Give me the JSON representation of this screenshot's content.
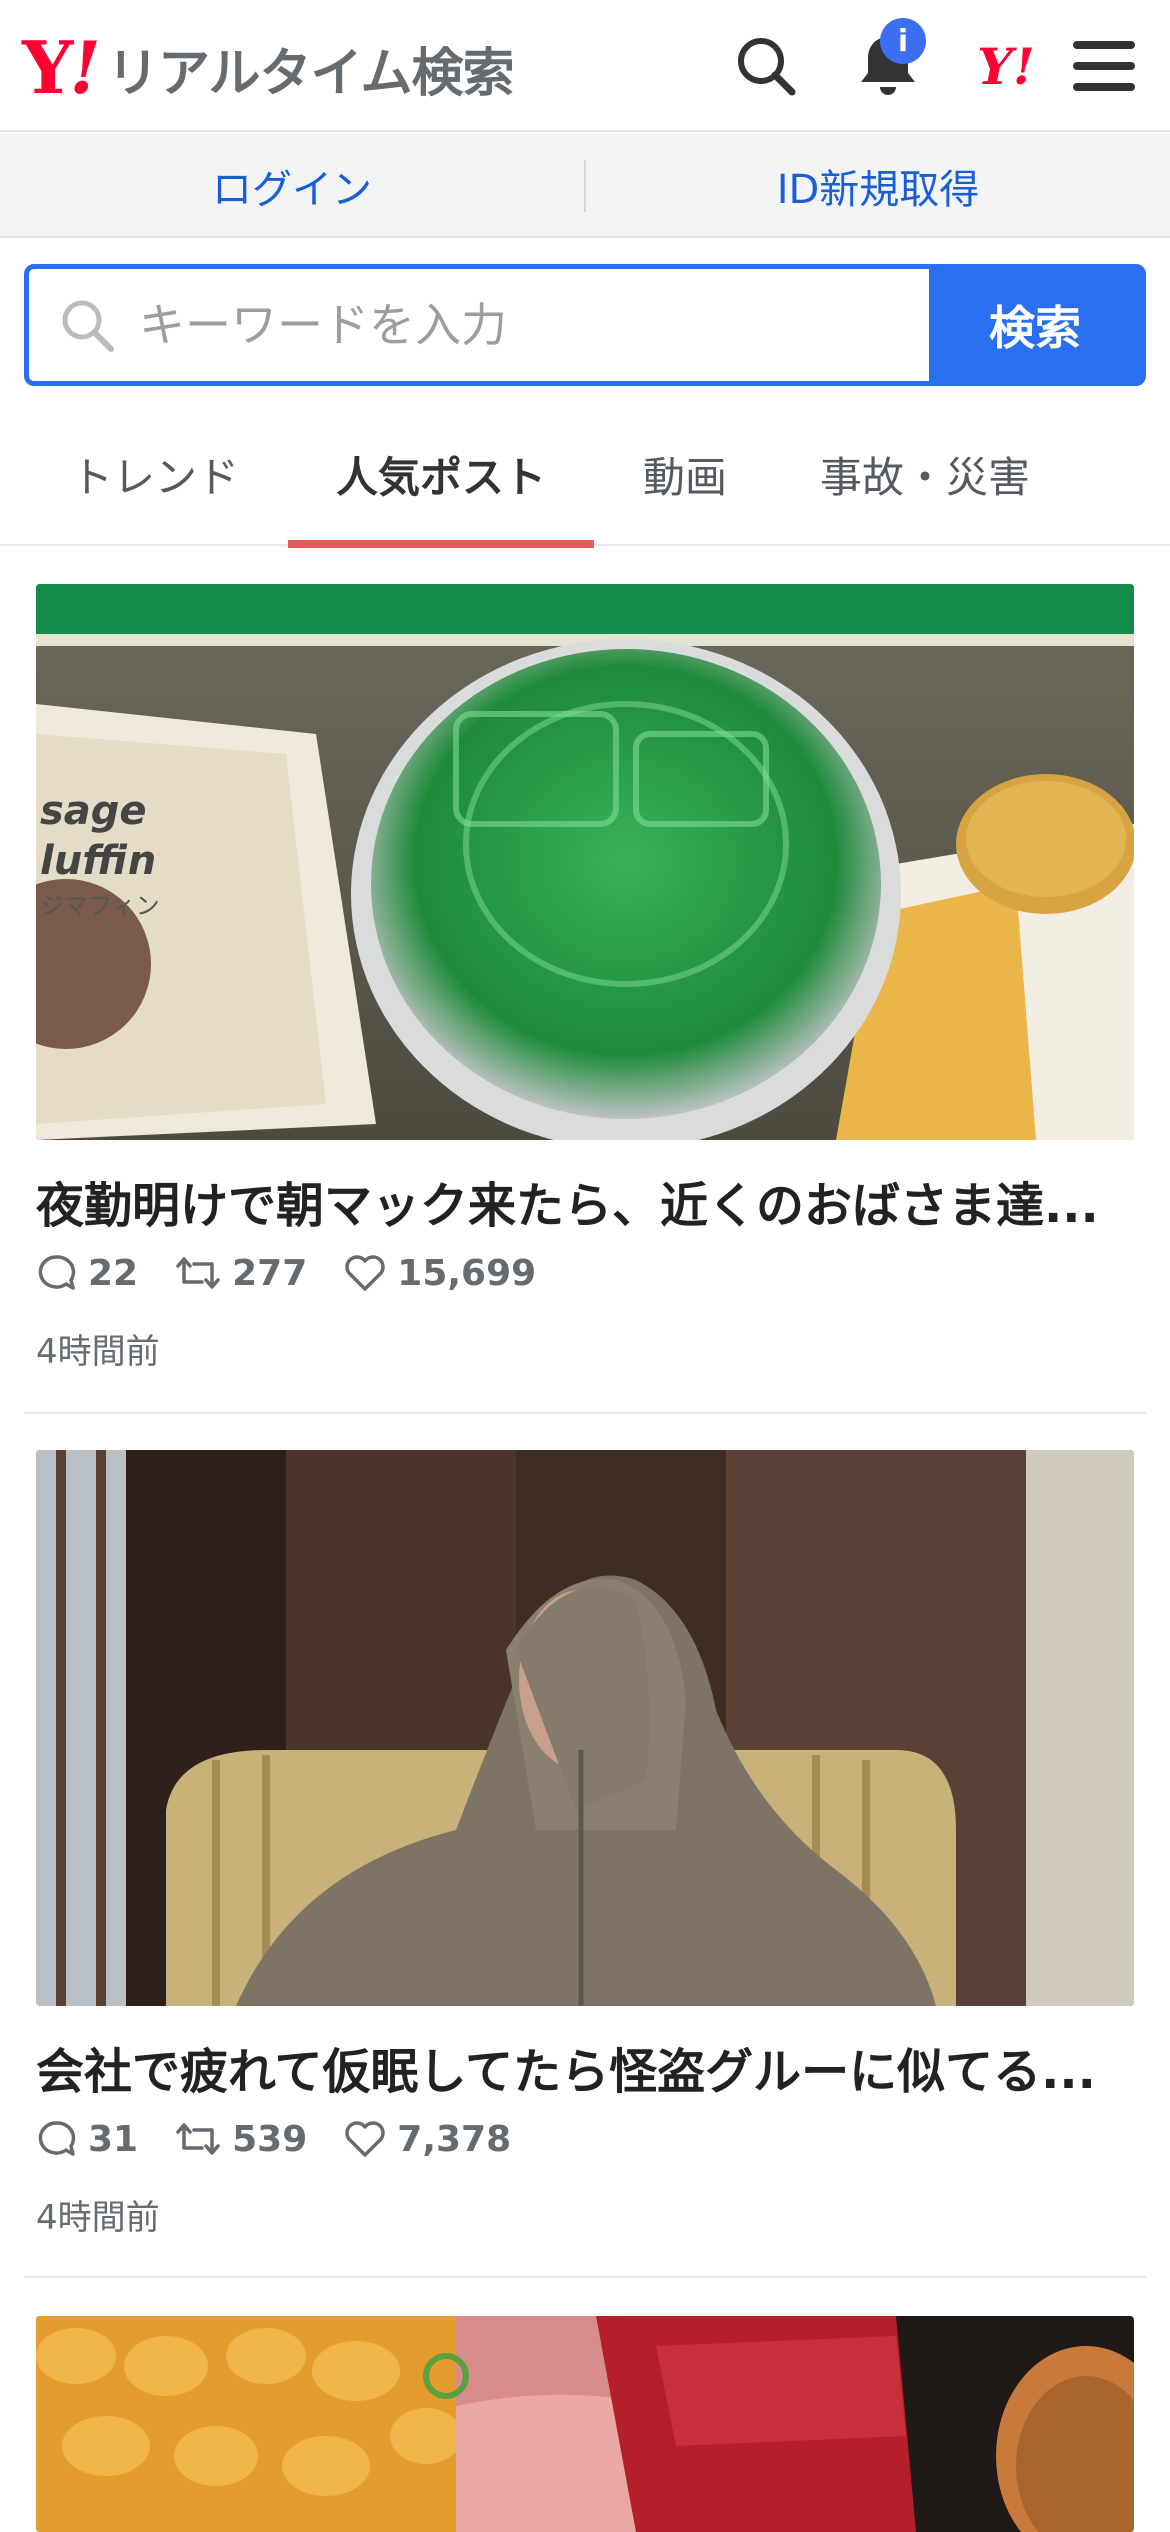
{
  "header": {
    "logo_mark": "Y",
    "logo_exclaim": "!",
    "logo_text": "リアルタイム検索",
    "notification_badge": "i",
    "yahoo_mini": "Y!"
  },
  "loginbar": {
    "login_label": "ログイン",
    "signup_label": "ID新規取得"
  },
  "search": {
    "placeholder": "キーワードを入力",
    "button_label": "検索"
  },
  "tabs": [
    {
      "label": "トレンド",
      "active": false
    },
    {
      "label": "人気ポスト",
      "active": true
    },
    {
      "label": "動画",
      "active": false
    },
    {
      "label": "事故・災害",
      "active": false
    }
  ],
  "posts": [
    {
      "title": "夜勤明けで朝マック来たら、近くのおばさま達...",
      "replies": "22",
      "reposts": "277",
      "likes": "15,699",
      "time": "4時間前",
      "image_text_1": "sage",
      "image_text_2": "luffin",
      "image_text_3": "ジマフィン"
    },
    {
      "title": "会社で疲れて仮眠してたら怪盗グルーに似てる...",
      "replies": "31",
      "reposts": "539",
      "likes": "7,378",
      "time": "4時間前"
    }
  ],
  "colors": {
    "accent_blue": "#2b6ff1",
    "brand_red": "#ff0033",
    "tab_underline": "#e35a5a"
  }
}
